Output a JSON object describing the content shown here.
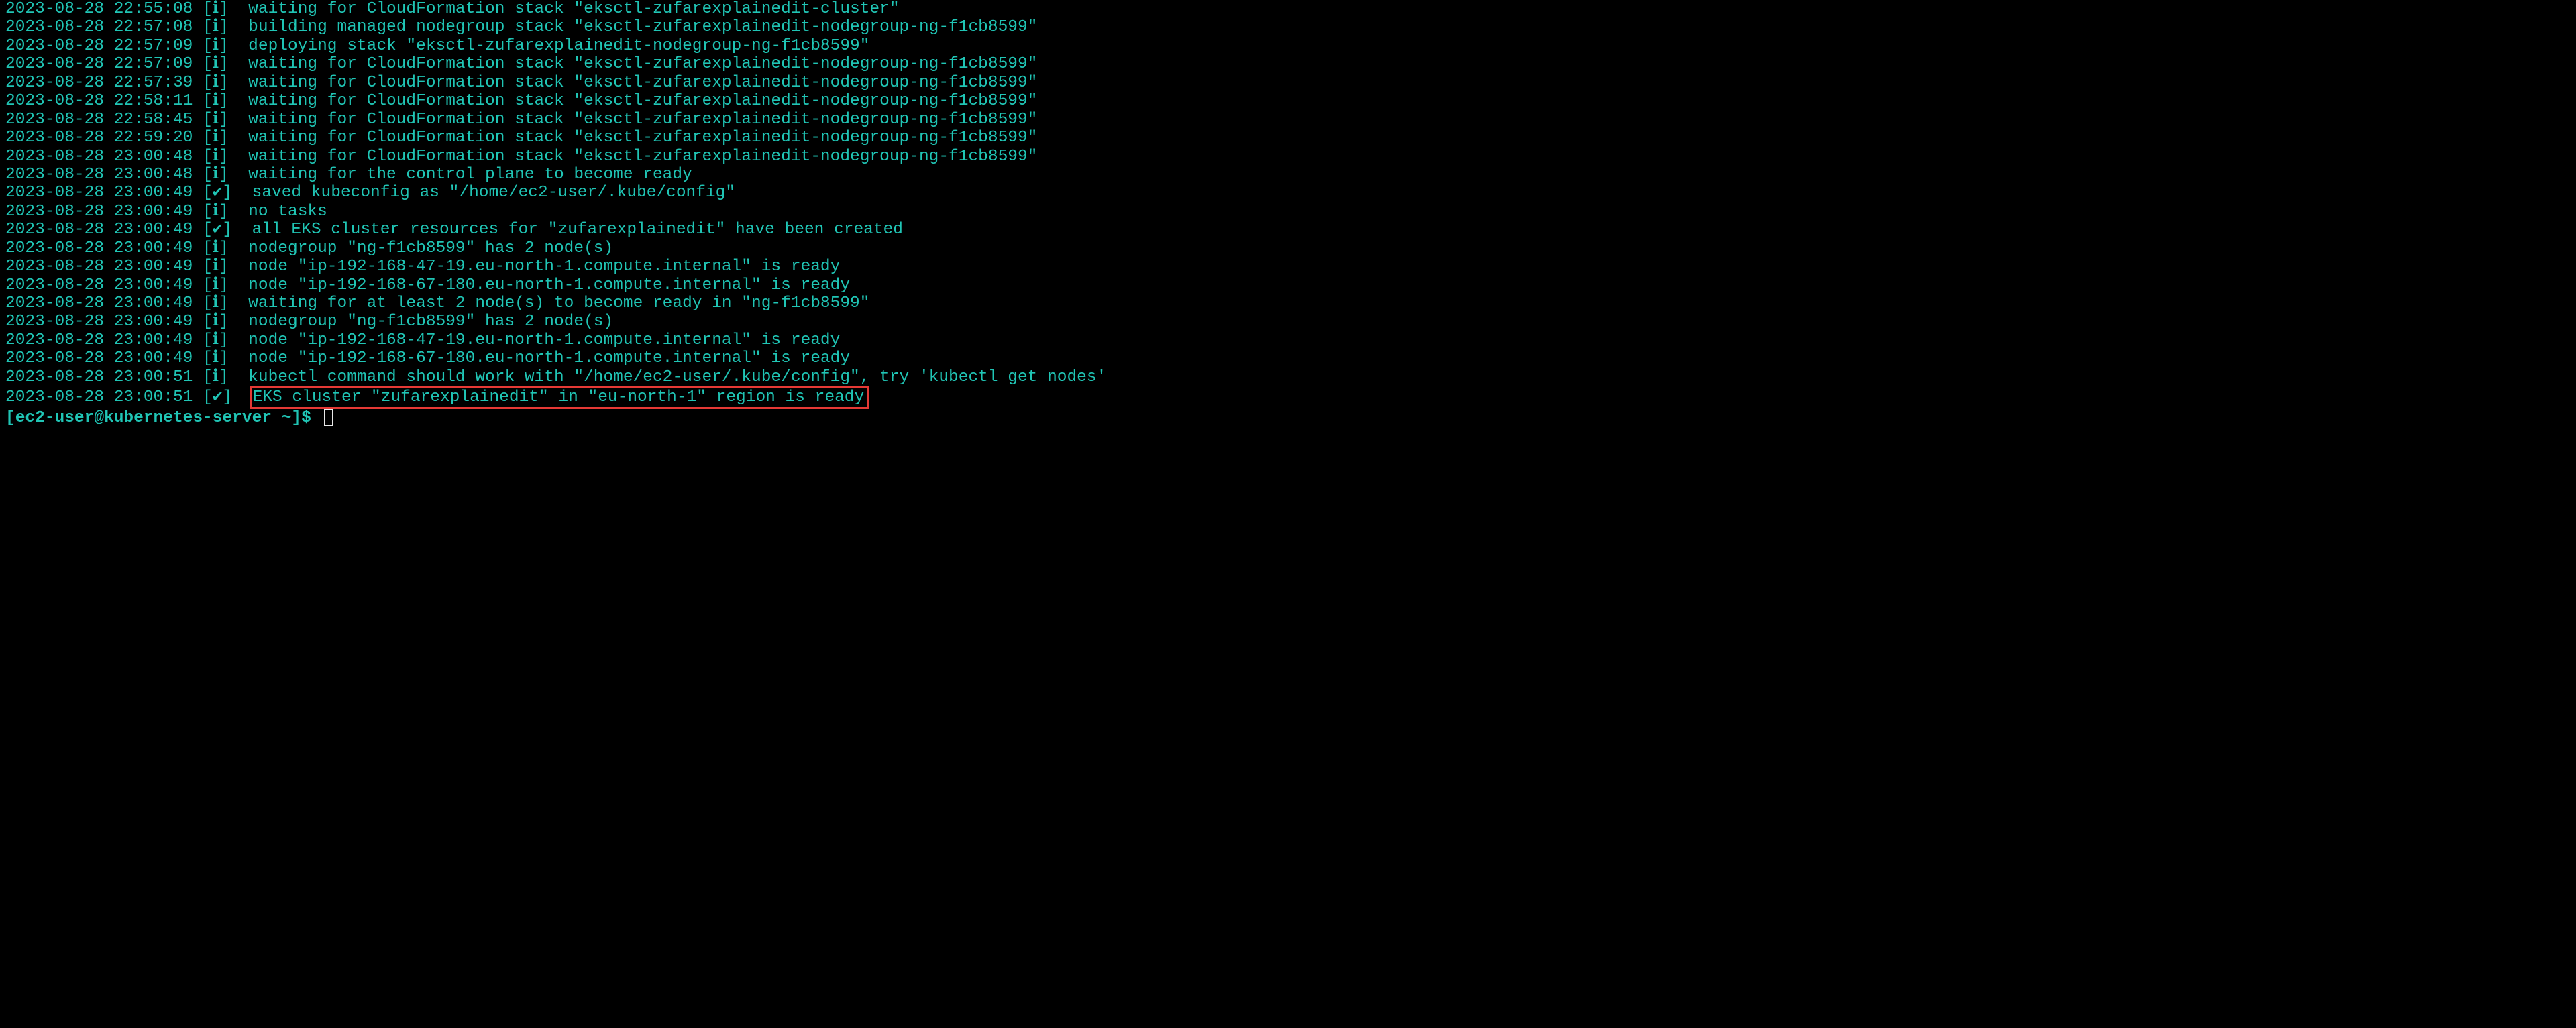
{
  "colors": {
    "background": "#000000",
    "text": "#2dd4bf",
    "highlight_border": "#e53935",
    "cursor_border": "#e8e8e8"
  },
  "log_lines": [
    {
      "ts": "2023-08-28 22:55:08",
      "lvl": "[ℹ]",
      "msg": "  waiting for CloudFormation stack \"eksctl-zufarexplainedit-cluster\""
    },
    {
      "ts": "2023-08-28 22:57:08",
      "lvl": "[ℹ]",
      "msg": "  building managed nodegroup stack \"eksctl-zufarexplainedit-nodegroup-ng-f1cb8599\""
    },
    {
      "ts": "2023-08-28 22:57:09",
      "lvl": "[ℹ]",
      "msg": "  deploying stack \"eksctl-zufarexplainedit-nodegroup-ng-f1cb8599\""
    },
    {
      "ts": "2023-08-28 22:57:09",
      "lvl": "[ℹ]",
      "msg": "  waiting for CloudFormation stack \"eksctl-zufarexplainedit-nodegroup-ng-f1cb8599\""
    },
    {
      "ts": "2023-08-28 22:57:39",
      "lvl": "[ℹ]",
      "msg": "  waiting for CloudFormation stack \"eksctl-zufarexplainedit-nodegroup-ng-f1cb8599\""
    },
    {
      "ts": "2023-08-28 22:58:11",
      "lvl": "[ℹ]",
      "msg": "  waiting for CloudFormation stack \"eksctl-zufarexplainedit-nodegroup-ng-f1cb8599\""
    },
    {
      "ts": "2023-08-28 22:58:45",
      "lvl": "[ℹ]",
      "msg": "  waiting for CloudFormation stack \"eksctl-zufarexplainedit-nodegroup-ng-f1cb8599\""
    },
    {
      "ts": "2023-08-28 22:59:20",
      "lvl": "[ℹ]",
      "msg": "  waiting for CloudFormation stack \"eksctl-zufarexplainedit-nodegroup-ng-f1cb8599\""
    },
    {
      "ts": "2023-08-28 23:00:48",
      "lvl": "[ℹ]",
      "msg": "  waiting for CloudFormation stack \"eksctl-zufarexplainedit-nodegroup-ng-f1cb8599\""
    },
    {
      "ts": "2023-08-28 23:00:48",
      "lvl": "[ℹ]",
      "msg": "  waiting for the control plane to become ready"
    },
    {
      "ts": "2023-08-28 23:00:49",
      "lvl": "[✔]",
      "msg": "  saved kubeconfig as \"/home/ec2-user/.kube/config\""
    },
    {
      "ts": "2023-08-28 23:00:49",
      "lvl": "[ℹ]",
      "msg": "  no tasks"
    },
    {
      "ts": "2023-08-28 23:00:49",
      "lvl": "[✔]",
      "msg": "  all EKS cluster resources for \"zufarexplainedit\" have been created"
    },
    {
      "ts": "2023-08-28 23:00:49",
      "lvl": "[ℹ]",
      "msg": "  nodegroup \"ng-f1cb8599\" has 2 node(s)"
    },
    {
      "ts": "2023-08-28 23:00:49",
      "lvl": "[ℹ]",
      "msg": "  node \"ip-192-168-47-19.eu-north-1.compute.internal\" is ready"
    },
    {
      "ts": "2023-08-28 23:00:49",
      "lvl": "[ℹ]",
      "msg": "  node \"ip-192-168-67-180.eu-north-1.compute.internal\" is ready"
    },
    {
      "ts": "2023-08-28 23:00:49",
      "lvl": "[ℹ]",
      "msg": "  waiting for at least 2 node(s) to become ready in \"ng-f1cb8599\""
    },
    {
      "ts": "2023-08-28 23:00:49",
      "lvl": "[ℹ]",
      "msg": "  nodegroup \"ng-f1cb8599\" has 2 node(s)"
    },
    {
      "ts": "2023-08-28 23:00:49",
      "lvl": "[ℹ]",
      "msg": "  node \"ip-192-168-47-19.eu-north-1.compute.internal\" is ready"
    },
    {
      "ts": "2023-08-28 23:00:49",
      "lvl": "[ℹ]",
      "msg": "  node \"ip-192-168-67-180.eu-north-1.compute.internal\" is ready"
    },
    {
      "ts": "2023-08-28 23:00:51",
      "lvl": "[ℹ]",
      "msg": "  kubectl command should work with \"/home/ec2-user/.kube/config\", try 'kubectl get nodes'"
    },
    {
      "ts": "2023-08-28 23:00:51",
      "lvl": "[✔]",
      "msg": "  EKS cluster \"zufarexplainedit\" in \"eu-north-1\" region is ready",
      "highlight": true
    }
  ],
  "prompt": {
    "open": "[",
    "user": "ec2-user",
    "at": "@",
    "host": "kubernetes-server",
    "space": " ",
    "path": "~",
    "close": "]",
    "symbol": "$ "
  }
}
